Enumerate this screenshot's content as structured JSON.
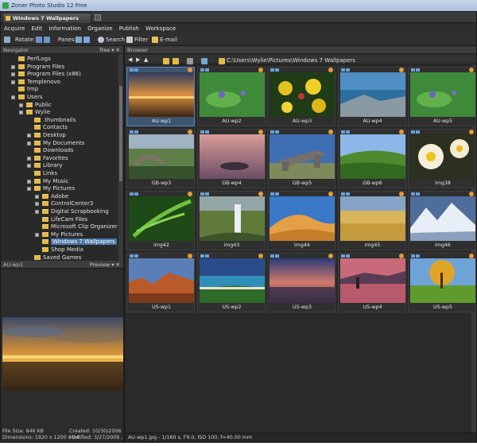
{
  "window": {
    "title": "Zoner Photo Studio 12 Free"
  },
  "tab": {
    "label": "Windows 7 Wallpapers"
  },
  "menu": [
    "Acquire",
    "Edit",
    "Information",
    "Organize",
    "Publish",
    "Workspace"
  ],
  "toolbar": {
    "rotate_label": "Rotate:",
    "panes_label": "Panes:",
    "search_label": "Search",
    "filter_label": "Filter",
    "email_label": "E-mail"
  },
  "navigator": {
    "title": "Navigator",
    "mode": "Tree",
    "items": [
      {
        "label": "PerfLogs",
        "level": 1,
        "expander": false
      },
      {
        "label": "Program Files",
        "level": 1,
        "expander": true
      },
      {
        "label": "Program Files (x86)",
        "level": 1,
        "expander": true
      },
      {
        "label": "Templenovo",
        "level": 1,
        "expander": true
      },
      {
        "label": "tmp",
        "level": 1,
        "expander": false
      },
      {
        "label": "Users",
        "level": 1,
        "expander": true
      },
      {
        "label": "Public",
        "level": 2,
        "expander": true
      },
      {
        "label": "Wylie",
        "level": 2,
        "expander": true
      },
      {
        "label": ".thumbnails",
        "level": 3,
        "expander": false
      },
      {
        "label": "Contacts",
        "level": 3,
        "expander": false
      },
      {
        "label": "Desktop",
        "level": 3,
        "expander": true
      },
      {
        "label": "My Documents",
        "level": 3,
        "expander": true
      },
      {
        "label": "Downloads",
        "level": 3,
        "expander": false
      },
      {
        "label": "Favorites",
        "level": 3,
        "expander": true
      },
      {
        "label": "Library",
        "level": 3,
        "expander": true
      },
      {
        "label": "Links",
        "level": 3,
        "expander": false
      },
      {
        "label": "My Music",
        "level": 3,
        "expander": true
      },
      {
        "label": "My Pictures",
        "level": 3,
        "expander": true
      },
      {
        "label": "Adobe",
        "level": 4,
        "expander": true
      },
      {
        "label": "ControlCenter3",
        "level": 4,
        "expander": true
      },
      {
        "label": "Digital Scrapbooking",
        "level": 4,
        "expander": true
      },
      {
        "label": "LifeCam Files",
        "level": 4,
        "expander": false
      },
      {
        "label": "Microsoft Clip Organizer",
        "level": 4,
        "expander": false
      },
      {
        "label": "My Pictures",
        "level": 4,
        "expander": true
      },
      {
        "label": "Windows 7 Wallpapers",
        "level": 4,
        "expander": false,
        "selected": true
      },
      {
        "label": "Shop Media",
        "level": 4,
        "expander": false
      },
      {
        "label": "Saved Games",
        "level": 3,
        "expander": false
      }
    ]
  },
  "preview": {
    "filename": "AU-wp1",
    "title": "Preview",
    "file_size": "File Size: 846 KB",
    "created": "Created: 10/30/2006 ...",
    "dimensions": "Dimensions: 1920 x 1200 x 24",
    "modified": "Modified: 3/27/2009 ..."
  },
  "browser": {
    "title": "Browser",
    "path": "C:\\Users\\Wylie\\Pictures\\Windows 7 Wallpapers",
    "thumbnails": [
      {
        "label": "AU-wp1",
        "selected": true,
        "theme": "sunset"
      },
      {
        "label": "AU-wp2",
        "theme": "green"
      },
      {
        "label": "AU-wp3",
        "theme": "flowers"
      },
      {
        "label": "AU-wp4",
        "theme": "coast"
      },
      {
        "label": "AU-wp5",
        "theme": "green"
      },
      {
        "label": "GB-wp3",
        "theme": "bridge"
      },
      {
        "label": "GB-wp4",
        "theme": "pink"
      },
      {
        "label": "GB-wp5",
        "theme": "stones"
      },
      {
        "label": "GB-wp6",
        "theme": "valley"
      },
      {
        "label": "img38",
        "theme": "frangipani"
      },
      {
        "label": "img42",
        "theme": "fern"
      },
      {
        "label": "img43",
        "theme": "waterfall"
      },
      {
        "label": "img44",
        "theme": "dune"
      },
      {
        "label": "img45",
        "theme": "wheat"
      },
      {
        "label": "img46",
        "theme": "snow"
      },
      {
        "label": "US-wp1",
        "theme": "canyon"
      },
      {
        "label": "US-wp2",
        "theme": "beach"
      },
      {
        "label": "US-wp3",
        "theme": "dusk"
      },
      {
        "label": "US-wp4",
        "theme": "lake"
      },
      {
        "label": "US-wp5",
        "theme": "meadow"
      }
    ]
  },
  "status": "AU-wp1.jpg - 1/160 s, F9.0, ISO 100, f=40.00 mm"
}
